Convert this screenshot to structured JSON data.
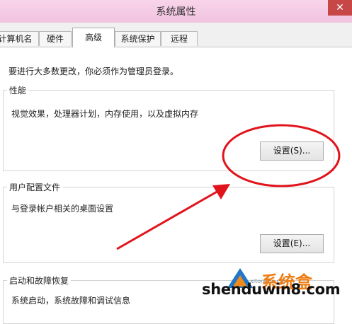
{
  "window": {
    "title": "系统属性",
    "close_glyph": "✕"
  },
  "tabs": [
    {
      "label": "计算机名"
    },
    {
      "label": "硬件"
    },
    {
      "label": "高级"
    },
    {
      "label": "系统保护"
    },
    {
      "label": "远程"
    }
  ],
  "active_tab_index": 2,
  "advanced": {
    "admin_note": "要进行大多数更改，你必须作为管理员登录。",
    "performance": {
      "title": "性能",
      "description": "视觉效果，处理器计划，内存使用，以及虚拟内存",
      "button": "设置(S)..."
    },
    "user_profiles": {
      "title": "用户配置文件",
      "description": "与登录帐户相关的桌面设置",
      "button": "设置(E)..."
    },
    "startup_recovery": {
      "title": "启动和故障恢复",
      "description": "系统启动，系统故障和调试信息"
    }
  },
  "annotation": {
    "color": "#e1141c"
  },
  "watermark": {
    "domain": "shenduwin8.com",
    "brand_text": "系统盒",
    "small_text": "xitonghe.com"
  },
  "colors": {
    "titlebar": "#f1c3df",
    "close_button": "#c74747",
    "annotation_red": "#e1141c"
  }
}
